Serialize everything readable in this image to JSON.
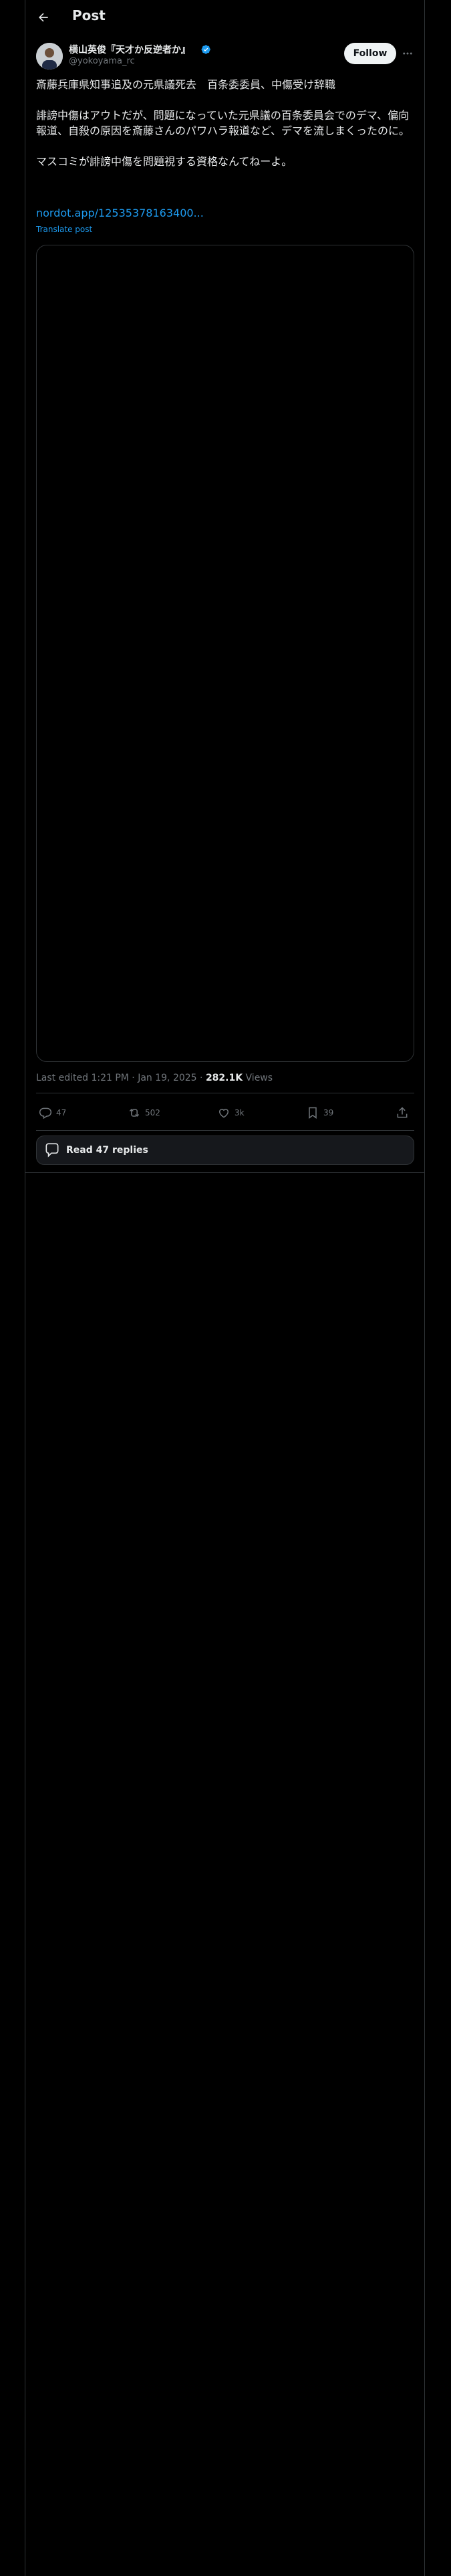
{
  "header": {
    "title": "Post"
  },
  "author": {
    "name": "横山英俊『天才か反逆者か』",
    "handle": "@yokoyama_rc",
    "follow_label": "Follow"
  },
  "post": {
    "paragraphs": [
      "斎藤兵庫県知事追及の元県議死去　百条委委員、中傷受け辞職",
      "誹謗中傷はアウトだが、問題になっていた元県議の百条委員会でのデマ、偏向報道、自殺の原因を斎藤さんのパワハラ報道など、デマを流しまくったのに。",
      "マスコミが誹謗中傷を問題視する資格なんてねーよ。"
    ],
    "link": "nordot.app/12535378163400...",
    "translate": "Translate post"
  },
  "meta": {
    "edited": "Last edited 1:21 PM · Jan 19, 2025 ·",
    "views_count": "282.1K",
    "views_label": "Views"
  },
  "actions": {
    "replies": "47",
    "reposts": "502",
    "likes": "3k",
    "bookmarks": "39"
  },
  "read_replies": {
    "label": "Read 47 replies"
  },
  "colors": {
    "accent": "#1d9bf0",
    "background": "#000000",
    "border": "#2f3336"
  },
  "icons": [
    "back-arrow-icon",
    "verified-icon",
    "more-icon",
    "reply-icon",
    "repost-icon",
    "like-icon",
    "bookmark-icon",
    "share-icon",
    "speech-bubble-icon"
  ]
}
